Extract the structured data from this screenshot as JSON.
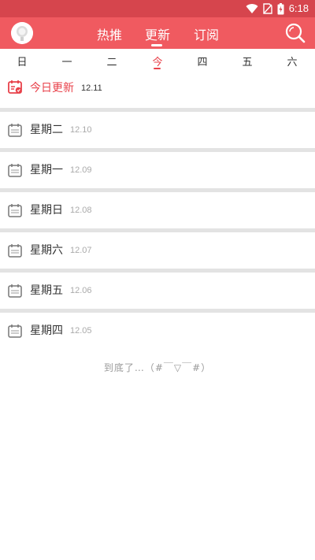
{
  "status_bar": {
    "time": "6:18",
    "icons": [
      "wifi-icon",
      "no-sim-icon",
      "battery-charging-icon"
    ],
    "color": "#d6454d"
  },
  "header": {
    "tabs": [
      {
        "label": "热推",
        "active": false
      },
      {
        "label": "更新",
        "active": true
      },
      {
        "label": "订阅",
        "active": false
      }
    ],
    "color": "#f05a60",
    "icons": [
      "avatar",
      "search-icon"
    ]
  },
  "week_tabs": [
    {
      "label": "日",
      "active": false
    },
    {
      "label": "一",
      "active": false
    },
    {
      "label": "二",
      "active": false
    },
    {
      "label": "今",
      "active": true
    },
    {
      "label": "四",
      "active": false
    },
    {
      "label": "五",
      "active": false
    },
    {
      "label": "六",
      "active": false
    }
  ],
  "schedule": [
    {
      "label": "今日更新",
      "date": "12.11",
      "today": true
    },
    {
      "label": "星期二",
      "date": "12.10",
      "today": false
    },
    {
      "label": "星期一",
      "date": "12.09",
      "today": false
    },
    {
      "label": "星期日",
      "date": "12.08",
      "today": false
    },
    {
      "label": "星期六",
      "date": "12.07",
      "today": false
    },
    {
      "label": "星期五",
      "date": "12.06",
      "today": false
    },
    {
      "label": "星期四",
      "date": "12.05",
      "today": false
    }
  ],
  "end_message": "到底了…（#￣▽￣#）",
  "accent_color": "#e8414a"
}
